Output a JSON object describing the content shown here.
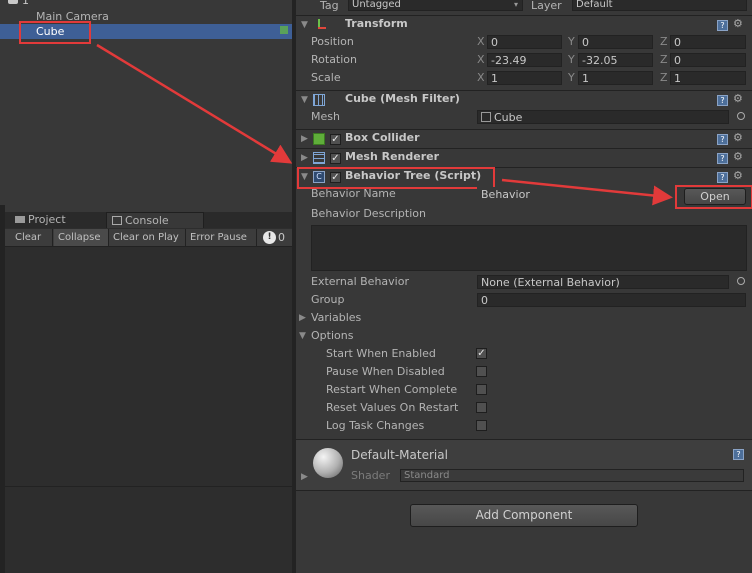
{
  "hierarchy": {
    "items": [
      "Main Camera",
      "Cube"
    ],
    "top_label": "1"
  },
  "bottom_tabs": [
    "Project",
    "Console"
  ],
  "console_toolbar": [
    "Clear",
    "Collapse",
    "Clear on Play",
    "Error Pause"
  ],
  "console_count": "0",
  "inspector": {
    "tag_label": "Tag",
    "tag_value": "Untagged",
    "layer_label": "Layer",
    "layer_value": "Default",
    "transform": {
      "title": "Transform",
      "rows": [
        {
          "label": "Position",
          "x": "0",
          "y": "0",
          "z": "0"
        },
        {
          "label": "Rotation",
          "x": "-23.49",
          "y": "-32.05",
          "z": "0"
        },
        {
          "label": "Scale",
          "x": "1",
          "y": "1",
          "z": "1"
        }
      ],
      "axes": [
        "X",
        "Y",
        "Z"
      ]
    },
    "mesh_filter": {
      "title": "Cube (Mesh Filter)",
      "mesh_label": "Mesh",
      "mesh_value": "Cube"
    },
    "box_collider": {
      "title": "Box Collider"
    },
    "mesh_renderer": {
      "title": "Mesh Renderer"
    },
    "behavior_tree": {
      "title": "Behavior Tree (Script)",
      "name_label": "Behavior Name",
      "name_value": "Behavior",
      "open_button": "Open",
      "desc_label": "Behavior Description",
      "external_label": "External Behavior",
      "external_value": "None (External Behavior)",
      "group_label": "Group",
      "group_value": "0",
      "variables_label": "Variables",
      "options_label": "Options",
      "options": [
        {
          "label": "Start When Enabled",
          "checked": true
        },
        {
          "label": "Pause When Disabled",
          "checked": false
        },
        {
          "label": "Restart When Complete",
          "checked": false
        },
        {
          "label": "Reset Values On Restart",
          "checked": false
        },
        {
          "label": "Log Task Changes",
          "checked": false
        }
      ]
    },
    "material": {
      "name": "Default-Material",
      "shader_label": "Shader",
      "shader_value": "Standard"
    },
    "add_component": "Add Component"
  },
  "colors": {
    "selection": "#3e5f96",
    "annotation": "#e23a3a"
  }
}
